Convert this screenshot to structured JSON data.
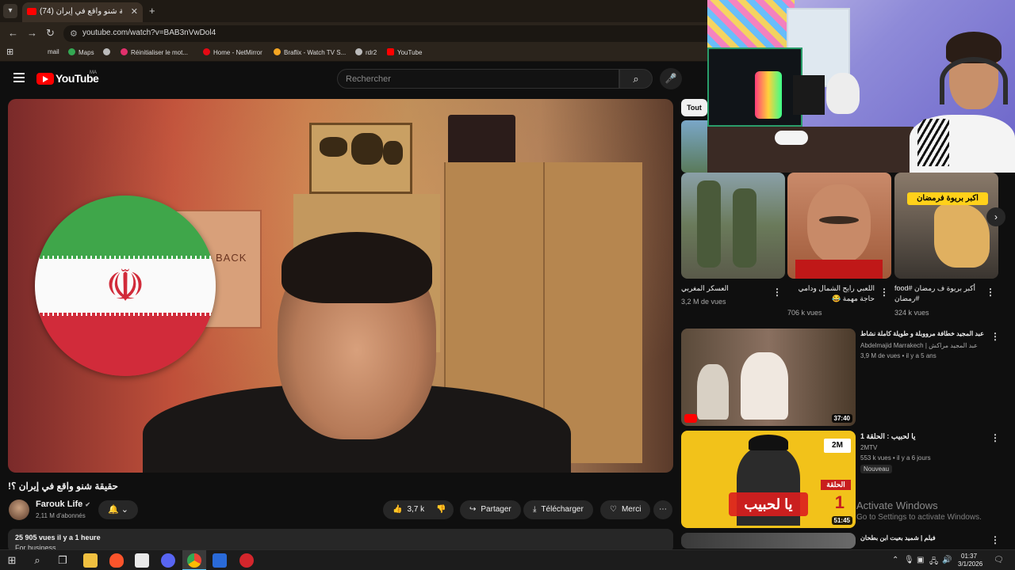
{
  "browser": {
    "tab_title": "(74) حقيقة شنو واقع في إيران",
    "url": "youtube.com/watch?v=BAB3nVwDol4",
    "bookmarks": [
      {
        "label": "mail",
        "color": "#ea4335"
      },
      {
        "label": "Maps",
        "color": "#34a853"
      },
      {
        "label": "",
        "color": "#bbbbbb"
      },
      {
        "label": "Réinitialiser le mot...",
        "color": "#e1306c"
      },
      {
        "label": "Home - NetMirror",
        "color": "#e50914"
      },
      {
        "label": "Braflix - Watch TV S...",
        "color": "#f5a623"
      },
      {
        "label": "rdr2",
        "color": "#bbbbbb"
      },
      {
        "label": "YouTube",
        "color": "#ff0000"
      }
    ]
  },
  "masthead": {
    "logo_text": "YouTube",
    "region": "MA",
    "search_placeholder": "Rechercher"
  },
  "video": {
    "overlay_text": "BACK",
    "title": "حقيقة شنو واقع في إيران ؟!",
    "channel": "Farouk Life",
    "subscribers": "2,11 M d'abonnés",
    "likes": "3,7 k",
    "share_label": "Partager",
    "download_label": "Télécharger",
    "thanks_label": "Merci",
    "views_time": "25 905 vues  il y a 1 heure",
    "description_snippet": "For business"
  },
  "sidebar": {
    "chip_all": "Tout",
    "shorts": [
      {
        "title": "العسكر المغربي",
        "views": "3,2 M de vues"
      },
      {
        "title": "اللعبي رايح الشمال ودامي حاجة مهمة 😂",
        "views": "706 k vues"
      },
      {
        "title": "أكبر بريوة ف رمضان #food #رمضان",
        "views": "324 k vues",
        "overlay": "اكبر بريوة فرمضان"
      }
    ],
    "recommendations": [
      {
        "title": "عبد المجيد خطافة مرووبلة و طويلة كاملة نشاط",
        "channel": "Abdelmajid Marrakech | عبد المجيد مراكش",
        "meta": "3,9 M de vues • il y a 5 ans",
        "duration": "37:40",
        "badge": ""
      },
      {
        "title": "يا لحبيب : الحلقة 1",
        "channel": "2MTV",
        "meta": "553 k vues • il y a 6 jours",
        "duration": "51:45",
        "badge": "Nouveau",
        "thumb_text": "يا لحبيب",
        "episode_label": "الحلقة",
        "episode_number": "1",
        "network": "2M"
      },
      {
        "title": "فيلم | شميد بعيت ابن بطحان",
        "channel": "",
        "meta": "",
        "duration": "",
        "badge": ""
      }
    ]
  },
  "windows_watermark": {
    "line1": "Activate Windows",
    "line2": "Go to Settings to activate Windows."
  },
  "taskbar": {
    "time": "01:37",
    "date": "3/1/2026"
  },
  "colors": {
    "youtube_red": "#ff0000",
    "background": "#0f0f0f",
    "chip_bg": "#272727"
  }
}
